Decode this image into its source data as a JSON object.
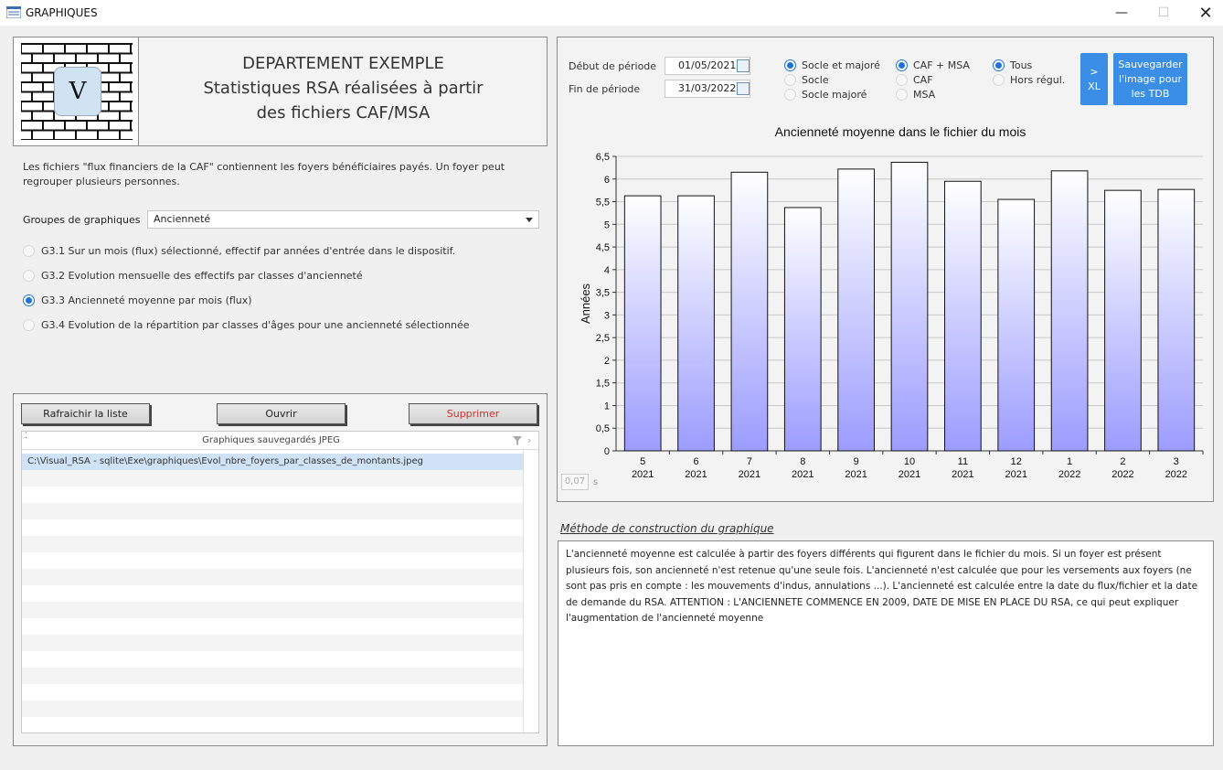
{
  "window": {
    "title": "GRAPHIQUES",
    "minimize": "—",
    "maximize": "☐",
    "close": "✕"
  },
  "header": {
    "logo_letter": "V",
    "line1": "DEPARTEMENT EXEMPLE",
    "line2": "Statistiques RSA réalisées à partir",
    "line3": "des fichiers CAF/MSA"
  },
  "description": "Les fichiers \"flux financiers de la CAF\" contiennent les foyers bénéficiaires payés. Un foyer peut regrouper plusieurs personnes.",
  "groups": {
    "label": "Groupes de graphiques",
    "selected": "Ancienneté"
  },
  "graph_options": [
    {
      "label": "G3.1 Sur un mois (flux) sélectionné, effectif par années d'entrée dans le dispositif.",
      "selected": false
    },
    {
      "label": "G3.2 Evolution mensuelle des effectifs par classes d'ancienneté",
      "selected": false
    },
    {
      "label": "G3.3 Ancienneté moyenne par mois (flux)",
      "selected": true
    },
    {
      "label": "G3.4 Evolution de la répartition par classes d'âges pour une ancienneté sélectionnée",
      "selected": false
    }
  ],
  "saved": {
    "refresh_label": "Rafraichir la liste",
    "open_label": "Ouvrir",
    "delete_label": "Supprimer",
    "list_title": "Graphiques sauvegardés  JPEG",
    "files": [
      "C:\\Visual_RSA - sqlite\\Exe\\graphiques\\Evol_nbre_foyers_par_classes_de_montants.jpeg"
    ]
  },
  "period": {
    "start_label": "Début de période",
    "start_value": "01/05/2021",
    "end_label": "Fin de période",
    "end_value": "31/03/2022"
  },
  "filters": {
    "group1": [
      {
        "label": "Socle et majoré",
        "selected": true
      },
      {
        "label": "Socle",
        "selected": false
      },
      {
        "label": "Socle majoré",
        "selected": false
      }
    ],
    "group2": [
      {
        "label": "CAF + MSA",
        "selected": true
      },
      {
        "label": "CAF",
        "selected": false
      },
      {
        "label": "MSA",
        "selected": false
      }
    ],
    "group3": [
      {
        "label": "Tous",
        "selected": true
      },
      {
        "label": "Hors régul.",
        "selected": false
      }
    ]
  },
  "buttons": {
    "xl_label_top": ">",
    "xl_label_bottom": "XL",
    "save_image_label": "Sauvegarder l'image pour les TDB"
  },
  "timer": {
    "value": "0,07",
    "unit": "s"
  },
  "colors": {
    "bar_top": "#ffffff",
    "bar_bottom": "#9c9cff",
    "accent": "#3a8ee6",
    "radio": "#1e73d8"
  },
  "chart_data": {
    "type": "bar",
    "title": "Ancienneté moyenne dans le fichier du mois",
    "ylabel": "Années",
    "xlabel": "",
    "categories": [
      [
        "5",
        "2021"
      ],
      [
        "6",
        "2021"
      ],
      [
        "7",
        "2021"
      ],
      [
        "8",
        "2021"
      ],
      [
        "9",
        "2021"
      ],
      [
        "10",
        "2021"
      ],
      [
        "11",
        "2021"
      ],
      [
        "12",
        "2021"
      ],
      [
        "1",
        "2022"
      ],
      [
        "2",
        "2022"
      ],
      [
        "3",
        "2022"
      ]
    ],
    "values": [
      5.63,
      5.63,
      6.15,
      5.37,
      6.22,
      6.37,
      5.95,
      5.55,
      6.18,
      5.75,
      5.77
    ],
    "ylim": [
      0,
      6.5
    ],
    "yticks": [
      "0",
      "0,5",
      "1",
      "1,5",
      "2",
      "2,5",
      "3",
      "3,5",
      "4",
      "4,5",
      "5",
      "5,5",
      "6",
      "6,5"
    ],
    "grid": true
  },
  "method": {
    "title": "Méthode de construction du graphique",
    "text": "L'ancienneté moyenne est calculée à partir des foyers différents qui figurent dans le fichier du mois. Si un foyer est présent plusieurs fois, son ancienneté n'est retenue qu'une seule fois. L'ancienneté n'est calculée que pour les versements aux foyers (ne sont pas pris en compte : les mouvements d'indus, annulations ...). L'ancienneté est calculée entre la date du flux/fichier et la date de demande du RSA. ATTENTION : L'ANCIENNETE COMMENCE EN 2009, DATE DE MISE EN PLACE DU RSA, ce qui peut expliquer l'augmentation de l'ancienneté moyenne"
  }
}
